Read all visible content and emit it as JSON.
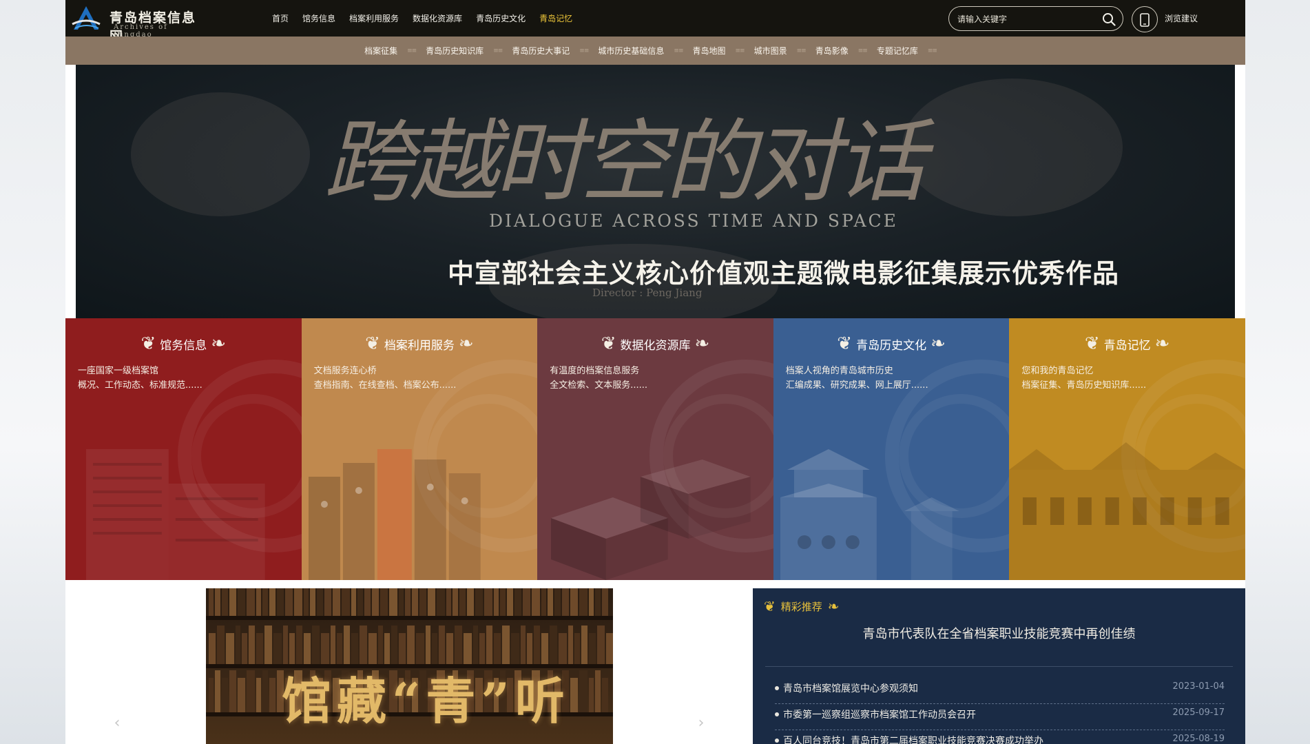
{
  "site": {
    "logo_cn": "青岛档案信息网",
    "logo_en": "Archives of Qingdao"
  },
  "nav": [
    {
      "label": "首页",
      "active": false
    },
    {
      "label": "馆务信息",
      "active": false
    },
    {
      "label": "档案利用服务",
      "active": false
    },
    {
      "label": "数据化资源库",
      "active": false
    },
    {
      "label": "青岛历史文化",
      "active": false
    },
    {
      "label": "青岛记忆",
      "active": true
    }
  ],
  "search": {
    "placeholder": "请输入关键字"
  },
  "mobile": {
    "label": "浏览建议"
  },
  "subnav": [
    "档案征集",
    "青岛历史知识库",
    "青岛历史大事记",
    "城市历史基础信息",
    "青岛地图",
    "城市图景",
    "青岛影像",
    "专题记忆库"
  ],
  "banner": {
    "title": "跨越时空的对话",
    "subtitle_en": "DIALOGUE ACROSS TIME AND SPACE",
    "caption": "中宣部社会主义核心价值观主题微电影征集展示优秀作品",
    "director": "Director : Peng Jiang"
  },
  "tiles": [
    {
      "title": "馆务信息",
      "line1": "一座国家一级档案馆",
      "line2": "概况、工作动态、标准规范......",
      "color": "#8f1d1e"
    },
    {
      "title": "档案利用服务",
      "line1": "文档服务连心桥",
      "line2": "查档指南、在线查档、档案公布......",
      "color": "#c0894e"
    },
    {
      "title": "数据化资源库",
      "line1": "有温度的档案信息服务",
      "line2": "全文检索、文本服务......",
      "color": "#6c3a40"
    },
    {
      "title": "青岛历史文化",
      "line1": "档案人视角的青岛城市历史",
      "line2": "汇编成果、研究成果、网上展厅......",
      "color": "#3a5f92"
    },
    {
      "title": "青岛记忆",
      "line1": "您和我的青岛记忆",
      "line2": "档案征集、青岛历史知识库......",
      "color": "#c08b22"
    }
  ],
  "video": {
    "title": "馆藏“青”听"
  },
  "carousel": {
    "prev": "‹",
    "next": "›"
  },
  "recommend": {
    "label": "精彩推荐",
    "featured": "青岛市代表队在全省档案职业技能竞赛中再创佳绩",
    "news": [
      {
        "title": "青岛市档案馆展览中心参观须知",
        "date": "2023-01-04"
      },
      {
        "title": "市委第一巡察组巡察市档案馆工作动员会召开",
        "date": "2025-09-17"
      },
      {
        "title": "百人同台竞技！青岛市第二届档案职业技能竞赛决赛成功举办",
        "date": "2025-08-19"
      }
    ]
  }
}
